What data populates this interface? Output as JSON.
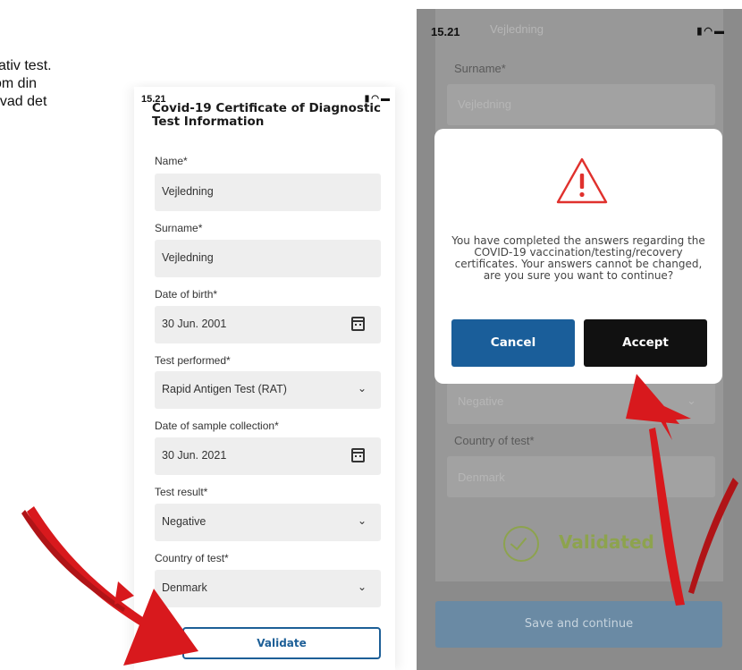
{
  "side_text": {
    "line1": "ativ test.",
    "line2": "om din",
    "line3": "hvad det"
  },
  "left_phone": {
    "status": {
      "time": "15.21",
      "icons": "signal wifi battery"
    },
    "title": "Covid-19 Certificate of Diagnostic Test Information",
    "fields": {
      "name": {
        "label": "Name*",
        "value": "Vejledning"
      },
      "surname": {
        "label": "Surname*",
        "value": "Vejledning"
      },
      "dob": {
        "label": "Date of birth*",
        "value": "30 Jun. 2001"
      },
      "test_performed": {
        "label": "Test performed*",
        "value": "Rapid Antigen Test (RAT)"
      },
      "sample_date": {
        "label": "Date of sample collection*",
        "value": "30 Jun. 2021"
      },
      "test_result": {
        "label": "Test result*",
        "value": "Negative"
      },
      "country": {
        "label": "Country of test*",
        "value": "Denmark"
      }
    },
    "validate_label": "Validate"
  },
  "right_phone": {
    "status": {
      "time": "15.21",
      "icons": "signal wifi battery"
    },
    "bg": {
      "top_value": "Vejledning",
      "surname_label": "Surname*",
      "surname_value": "Vejledning",
      "result_value": "Negative",
      "country_label": "Country of test*",
      "country_value": "Denmark",
      "validated_label": "Validated"
    },
    "save_label": "Save and continue",
    "modal": {
      "icon": "warning-triangle-icon",
      "message": "You have completed the answers regarding the COVID-19 vaccination/testing/recovery certificates. Your answers cannot be changed, are you sure you want to continue?",
      "cancel_label": "Cancel",
      "accept_label": "Accept"
    }
  },
  "colors": {
    "primary_blue": "#1a5e9a",
    "accept_black": "#111111",
    "validated_green": "#8da34e",
    "warning_red": "#e0312d",
    "arrow_red": "#d8191d"
  }
}
